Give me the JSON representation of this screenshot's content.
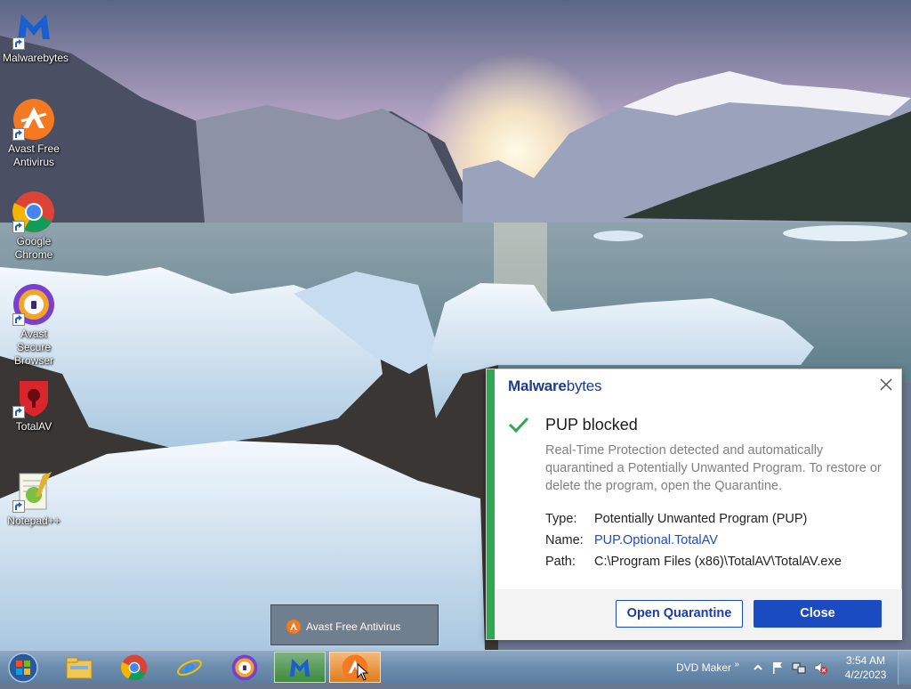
{
  "desktop": {
    "icons": [
      {
        "label": "Malwarebytes",
        "icon": "malwarebytes-icon"
      },
      {
        "label": "Avast Free Antivirus",
        "icon": "avast-icon"
      },
      {
        "label": "Google Chrome",
        "icon": "chrome-icon"
      },
      {
        "label": "Avast Secure Browser",
        "icon": "avast-secure-browser-icon"
      },
      {
        "label": "TotalAV",
        "icon": "totalav-icon"
      },
      {
        "label": "Notepad++",
        "icon": "notepadpp-icon"
      }
    ]
  },
  "taskbar_popup": {
    "label": "Avast Free Antivirus"
  },
  "toast": {
    "brand_bold": "Malware",
    "brand_light": "bytes",
    "heading": "PUP blocked",
    "description": "Real-Time Protection detected and automatically quarantined a Potentially Unwanted Program. To restore or delete the program, open the Quarantine.",
    "details": [
      {
        "key": "Type:",
        "value": "Potentially Unwanted Program (PUP)"
      },
      {
        "key": "Name:",
        "value": "PUP.Optional.TotalAV"
      },
      {
        "key": "Path:",
        "value": "C:\\Program Files (x86)\\TotalAV\\TotalAV.exe"
      }
    ],
    "open_quarantine_label": "Open Quarantine",
    "close_label": "Close",
    "accent_color": "#2fa84f",
    "button_color": "#1a4bc0"
  },
  "taskbar": {
    "pinned": [
      "start-orb",
      "explorer-icon",
      "chrome-icon",
      "ie-icon",
      "avast-secure-browser-icon",
      "malwarebytes-icon",
      "avast-icon"
    ],
    "toolbar_label": "DVD Maker",
    "toolbar_chevron": "»",
    "time": "3:54 AM",
    "date": "4/2/2023"
  }
}
